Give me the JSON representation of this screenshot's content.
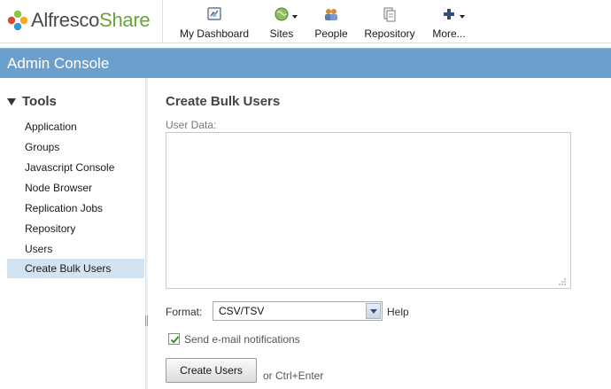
{
  "header": {
    "logo_text": "Alfresco",
    "logo_brand": "Share",
    "nav": [
      {
        "label": "My Dashboard",
        "icon": "dashboard-icon"
      },
      {
        "label": "Sites",
        "icon": "sites-globe-icon"
      },
      {
        "label": "People",
        "icon": "people-icon"
      },
      {
        "label": "Repository",
        "icon": "repository-icon"
      },
      {
        "label": "More...",
        "icon": "plus-icon"
      }
    ]
  },
  "title_band": {
    "title": "Admin Console"
  },
  "sidebar": {
    "heading": "Tools",
    "items": [
      {
        "label": "Application"
      },
      {
        "label": "Groups"
      },
      {
        "label": "Javascript Console"
      },
      {
        "label": "Node Browser"
      },
      {
        "label": "Replication Jobs"
      },
      {
        "label": "Repository"
      },
      {
        "label": "Users"
      },
      {
        "label": "Create Bulk Users",
        "active": true
      }
    ]
  },
  "main": {
    "title": "Create Bulk Users",
    "user_data_label": "User Data:",
    "user_data_value": "",
    "format_label": "Format:",
    "format_value": "CSV/TSV",
    "help_label": "Help",
    "notify_label": "Send e-mail notifications",
    "notify_checked": true,
    "create_button": "Create Users",
    "shortcut_hint": "or Ctrl+Enter"
  },
  "colors": {
    "title_band": "#6ba0cc",
    "active_item": "#d2e3f2",
    "logo_green": "#5a8f29"
  }
}
